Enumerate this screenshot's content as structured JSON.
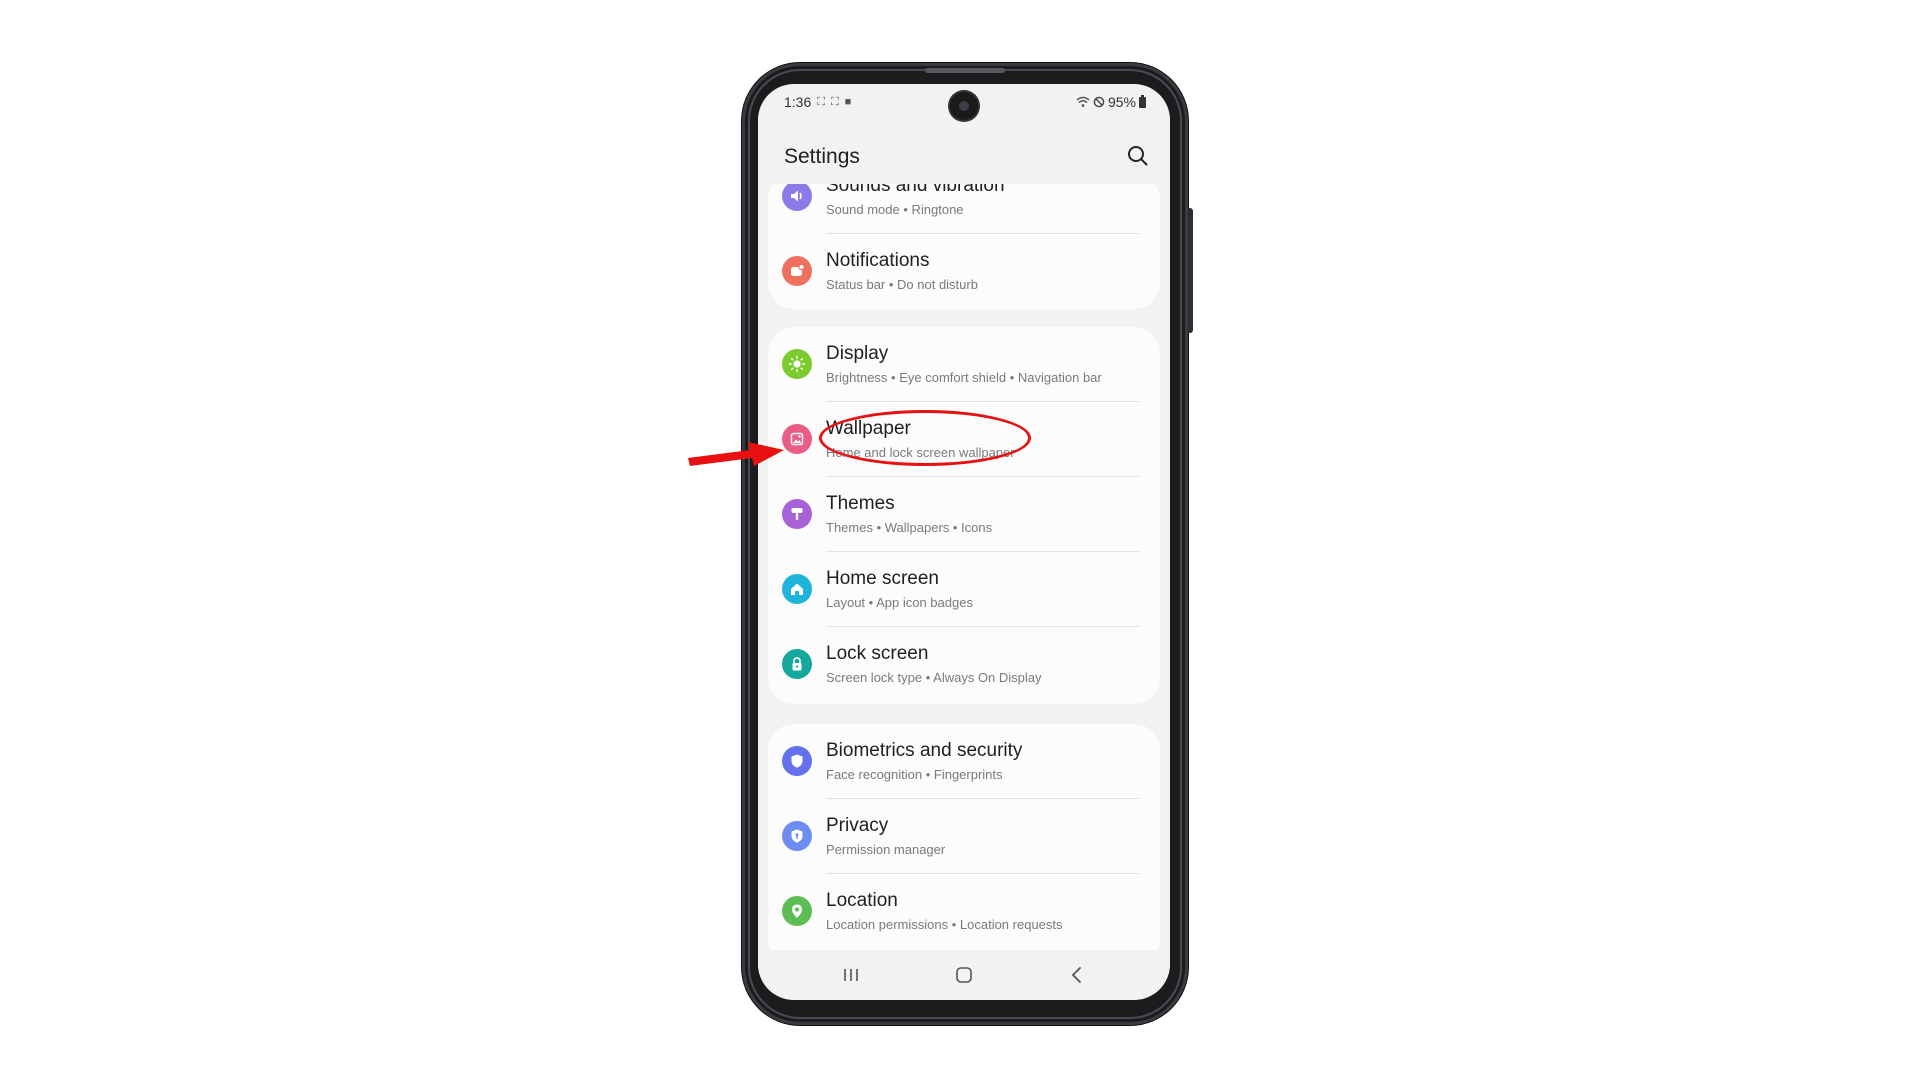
{
  "status_bar": {
    "time": "1:36",
    "battery": "95%"
  },
  "header": {
    "title": "Settings"
  },
  "settings": [
    {
      "id": "sounds",
      "title": "Sounds and vibration",
      "subtitle": "Sound mode  •  Ringtone",
      "icon": "speaker-icon",
      "color": "#8b7be8"
    },
    {
      "id": "notifications",
      "title": "Notifications",
      "subtitle": "Status bar  •  Do not disturb",
      "icon": "notification-icon",
      "color": "#f0705f"
    },
    {
      "id": "display",
      "title": "Display",
      "subtitle": "Brightness  •  Eye comfort shield  •  Navigation bar",
      "icon": "sun-icon",
      "color": "#7ccb2e"
    },
    {
      "id": "wallpaper",
      "title": "Wallpaper",
      "subtitle": "Home and lock screen wallpaper",
      "icon": "image-icon",
      "color": "#ec5d86"
    },
    {
      "id": "themes",
      "title": "Themes",
      "subtitle": "Themes  •  Wallpapers  •  Icons",
      "icon": "paint-roller-icon",
      "color": "#a862d8"
    },
    {
      "id": "home_screen",
      "title": "Home screen",
      "subtitle": "Layout  •  App icon badges",
      "icon": "home-icon",
      "color": "#1fb4d9"
    },
    {
      "id": "lock_screen",
      "title": "Lock screen",
      "subtitle": "Screen lock type  •  Always On Display",
      "icon": "lock-icon",
      "color": "#16a89c"
    },
    {
      "id": "biometrics",
      "title": "Biometrics and security",
      "subtitle": "Face recognition  •  Fingerprints",
      "icon": "shield-icon",
      "color": "#6471ec"
    },
    {
      "id": "privacy",
      "title": "Privacy",
      "subtitle": "Permission manager",
      "icon": "privacy-shield-icon",
      "color": "#6e8df0"
    },
    {
      "id": "location",
      "title": "Location",
      "subtitle": "Location permissions  •  Location requests",
      "icon": "location-pin-icon",
      "color": "#5dbd55"
    }
  ],
  "colors": {
    "annotation": "#e81010",
    "screen_bg": "#f2f2f2",
    "card_bg": "#fcfcfc"
  }
}
